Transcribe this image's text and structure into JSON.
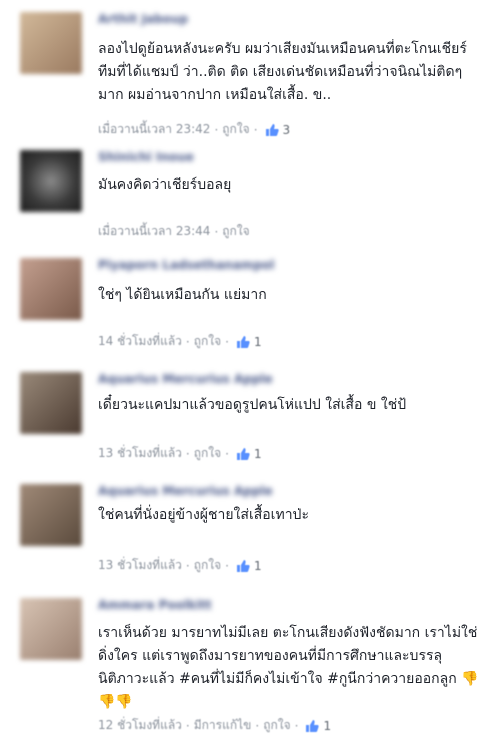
{
  "comments": [
    {
      "name": "Arthit Jaboup",
      "text": "ลองไปดูย้อนหลังนะครับ ผมว่าเสียงมันเหมือนคนที่ตะโกนเชียร์ ทีมที่ได้แชมป์ ว่า..ติด ติด เสียงเด่นชัดเหมือนที่ว่าจนิณไม่ติดๆ มาก ผมอ่านจากปาก เหมือนใส่เสื้อ. ข..",
      "time": "เมื่อวานนี้เวลา 23:42",
      "like_label": "ถูกใจ",
      "likes": "3",
      "avatar_color": "#b89a7c"
    },
    {
      "name": "Shinichi Inoue",
      "text": "มันคงคิดว่าเชียร์บอลยุ",
      "time": "เมื่อวานนี้เวลา 23:44",
      "like_label": "ถูกใจ",
      "likes": "",
      "avatar_color": "#3a3a3a"
    },
    {
      "name": "Piyaporn Ladsethanampol",
      "text": "ใช่ๆ ได้ยินเหมือนกัน แย่มาก",
      "time": "14 ชั่วโมงที่แล้ว",
      "like_label": "ถูกใจ",
      "likes": "1",
      "avatar_color": "#a07a6a"
    },
    {
      "name": "Aquarius Mercurius Apple",
      "text": "เดี๋ยวนะแคปมาแล้วขอดูรูปคนโห่แปป ใส่เสื้อ ข ใช่ป้",
      "time": "13 ชั่วโมงที่แล้ว",
      "like_label": "ถูกใจ",
      "likes": "1",
      "avatar_color": "#7a6a5a"
    },
    {
      "name": "Aquarius Mercurius Apple",
      "text": "ใช่คนที่นั่งอยู่ข้างผู้ชายใส่เสื้อเทาป่ะ",
      "time": "13 ชั่วโมงที่แล้ว",
      "like_label": "ถูกใจ",
      "likes": "1",
      "avatar_color": "#7a6a5a"
    },
    {
      "name": "Ammara Poolkitt",
      "text": "เราเห็นด้วย มารยาทไม่มีเลย ตะโกนเสียงดังฟังชัดมาก เราไม่ใช่ดิ่งใคร แต่เราพูดถึงมารยาทของคนที่มีการศึกษาและบรรลุนิติภาวะแล้ว #คนที่ไม่มีก็คงไม่เข้าใจ #กูนีกว่าควายออกลูก 👎👎👎",
      "time": "12 ชั่วโมงที่แล้ว",
      "edited": "มีการแก้ไข",
      "like_label": "ถูกใจ",
      "likes": "1",
      "avatar_color": "#c2a89a"
    }
  ],
  "colors": {
    "name": "#4b5a8a",
    "meta": "#8d949e",
    "like_icon": "#5890ff"
  }
}
